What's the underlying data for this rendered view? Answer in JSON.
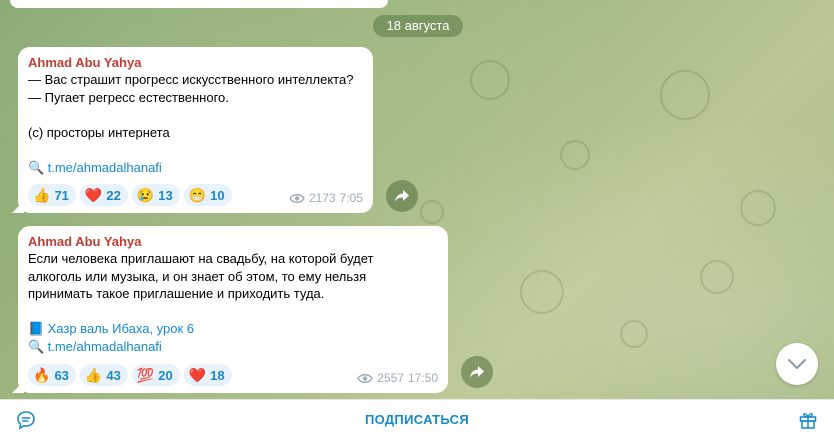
{
  "date_separator": "18 августа",
  "messages": [
    {
      "author": "Ahmad Abu Yahya",
      "lines": [
        "— Вас страшит прогресс искусственного интеллекта?",
        "— Пугает регресс естественного.",
        "",
        "(с) просторы интернета",
        ""
      ],
      "links": [
        {
          "icon": "🔍",
          "text": "t.me/ahmadalhanafi"
        }
      ],
      "reactions": [
        {
          "emoji": "👍",
          "count": "71"
        },
        {
          "emoji": "❤️",
          "count": "22"
        },
        {
          "emoji": "😢",
          "count": "13"
        },
        {
          "emoji": "😁",
          "count": "10"
        }
      ],
      "views": "2173",
      "time": "7:05"
    },
    {
      "author": "Ahmad Abu Yahya",
      "lines": [
        "Если человека приглашают на свадьбу, на которой будет",
        "алкоголь или музыка, и он знает об этом, то ему нельзя",
        "принимать такое приглашение и приходить туда.",
        ""
      ],
      "links": [
        {
          "icon": "📘",
          "text": "Хазр валь Ибаха, урок 6"
        },
        {
          "icon": "🔍",
          "text": "t.me/ahmadalhanafi"
        }
      ],
      "reactions": [
        {
          "emoji": "🔥",
          "count": "63"
        },
        {
          "emoji": "👍",
          "count": "43"
        },
        {
          "emoji": "💯",
          "count": "20"
        },
        {
          "emoji": "❤️",
          "count": "18"
        }
      ],
      "views": "2557",
      "time": "17:50"
    }
  ],
  "footer": {
    "subscribe_label": "ПОДПИСАТЬСЯ"
  },
  "colors": {
    "author": "#c03d33",
    "link": "#168acd",
    "reaction_bg": "#e8f2fb"
  }
}
